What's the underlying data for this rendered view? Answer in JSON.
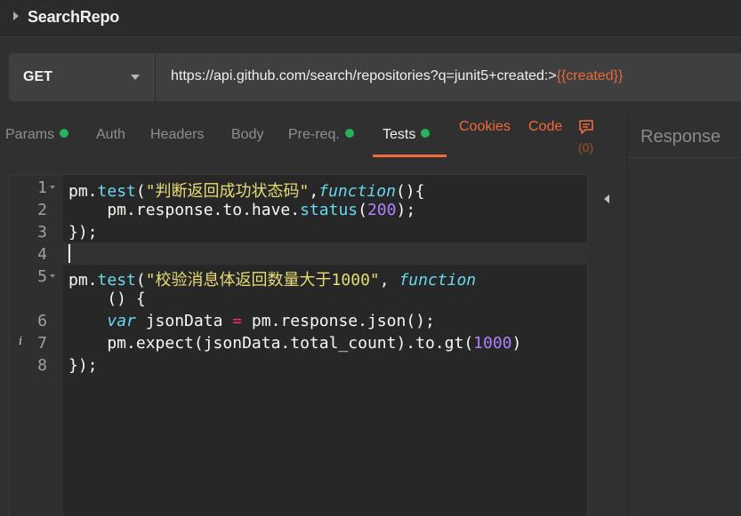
{
  "title_bar": {
    "title": "SearchRepo"
  },
  "request": {
    "method": "GET",
    "url_base": "https://api.github.com/search/repositories?q=junit5+created:>",
    "url_variable": "{{created}}"
  },
  "tabs": [
    {
      "label": "Params",
      "dot": true
    },
    {
      "label": "Auth",
      "dot": false
    },
    {
      "label": "Headers",
      "dot": false
    },
    {
      "label": "Body",
      "dot": false
    },
    {
      "label": "Pre-req.",
      "dot": true
    },
    {
      "label": "Tests",
      "dot": true,
      "active": true
    }
  ],
  "links": {
    "cookies": "Cookies",
    "code": "Code"
  },
  "comments": {
    "count": "(0)"
  },
  "response": {
    "label": "Response"
  },
  "editor": {
    "line_numbers": [
      "1",
      "2",
      "3",
      "4",
      "5",
      "6",
      "7",
      "8"
    ],
    "lines": {
      "l1": {
        "obj": "pm.",
        "fn": "test",
        "open": "(",
        "str": "\"判断返回成功状态码\"",
        "sep": ",",
        "kw": "function",
        "rest": "(){"
      },
      "l2": {
        "pre": "    pm.response.to.have.",
        "fn": "status",
        "open": "(",
        "num": "200",
        "close": ");"
      },
      "l3": {
        "text": "});"
      },
      "l5": {
        "obj": "pm.",
        "fn": "test",
        "open": "(",
        "str": "\"校验消息体返回数量大于1000\"",
        "sep": ", ",
        "kw": "function"
      },
      "l5b": {
        "text": "    () {"
      },
      "l6": {
        "kw": "var",
        "mid": " jsonData ",
        "op": "=",
        "rest": " pm.response.json();"
      },
      "l7": {
        "pre": "    pm.expect(jsonData.total_count).to.gt(",
        "num": "1000",
        "close": ")"
      },
      "l8": {
        "text": "});"
      }
    }
  },
  "colors": {
    "accent": "#f26b3a",
    "status_dot": "#25b25a",
    "variable": "#e8693b"
  }
}
